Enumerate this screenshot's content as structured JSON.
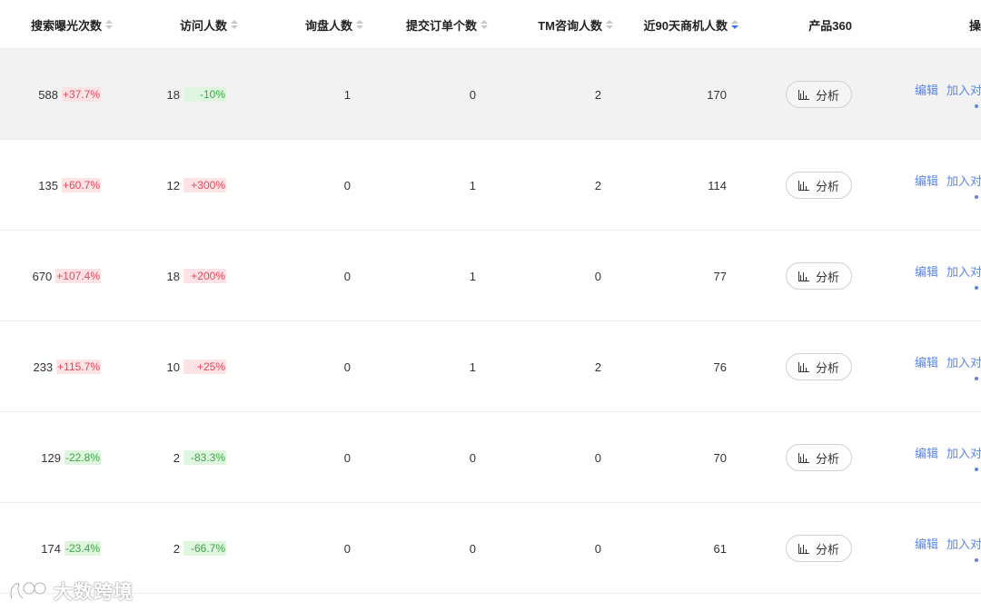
{
  "columns": {
    "search_exposure": "搜索曝光次数",
    "visitors": "访问人数",
    "inquiry": "询盘人数",
    "orders": "提交订单个数",
    "tm_consult": "TM咨询人数",
    "buyers_90d": "近90天商机人数",
    "product360": "产品360",
    "operations": "操"
  },
  "sort": {
    "active_column": "buyers_90d",
    "direction": "desc"
  },
  "analyze_label": "分析",
  "edit_label": "编辑",
  "compare_label": "加入对",
  "rows": [
    {
      "exposure": "588",
      "exposure_change": "+37.7%",
      "exposure_trend": "up",
      "visitors": "18",
      "visitors_change": "-10%",
      "visitors_trend": "down",
      "inquiry": "1",
      "orders": "0",
      "tm": "2",
      "buyers": "170"
    },
    {
      "exposure": "135",
      "exposure_change": "+60.7%",
      "exposure_trend": "up",
      "visitors": "12",
      "visitors_change": "+300%",
      "visitors_trend": "up",
      "inquiry": "0",
      "orders": "1",
      "tm": "2",
      "buyers": "114"
    },
    {
      "exposure": "670",
      "exposure_change": "+107.4%",
      "exposure_trend": "up",
      "visitors": "18",
      "visitors_change": "+200%",
      "visitors_trend": "up",
      "inquiry": "0",
      "orders": "1",
      "tm": "0",
      "buyers": "77"
    },
    {
      "exposure": "233",
      "exposure_change": "+115.7%",
      "exposure_trend": "up",
      "visitors": "10",
      "visitors_change": "+25%",
      "visitors_trend": "up",
      "inquiry": "0",
      "orders": "1",
      "tm": "2",
      "buyers": "76"
    },
    {
      "exposure": "129",
      "exposure_change": "-22.8%",
      "exposure_trend": "down",
      "visitors": "2",
      "visitors_change": "-83.3%",
      "visitors_trend": "down",
      "inquiry": "0",
      "orders": "0",
      "tm": "0",
      "buyers": "70"
    },
    {
      "exposure": "174",
      "exposure_change": "-23.4%",
      "exposure_trend": "down",
      "visitors": "2",
      "visitors_change": "-66.7%",
      "visitors_trend": "down",
      "inquiry": "0",
      "orders": "0",
      "tm": "0",
      "buyers": "61"
    }
  ],
  "colors": {
    "increase_text": "#e8465a",
    "increase_bg": "#fde3e6",
    "decrease_text": "#3aa945",
    "decrease_bg": "#dff5df",
    "link": "#5a86e8",
    "active_sort": "#3d6ff0",
    "hover_row": "#f2f2f2"
  },
  "icons": {
    "sort": "sort-caret-icon",
    "analyze": "bar-chart-icon",
    "watermark": "logo-icon"
  },
  "watermark": "大数跨境"
}
